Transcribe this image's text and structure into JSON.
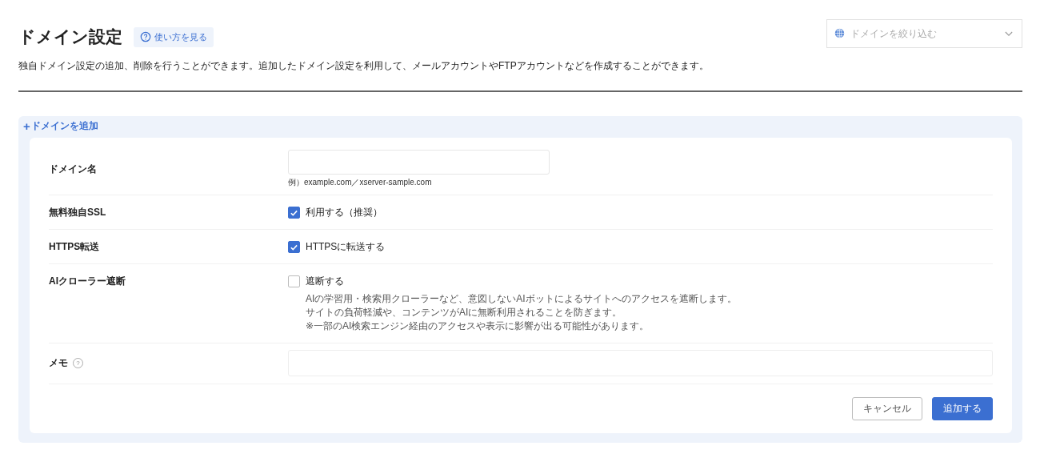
{
  "header": {
    "title": "ドメイン設定",
    "help_link": "使い方を見る",
    "filter": {
      "placeholder": "ドメインを絞り込む"
    },
    "description": "独自ドメイン設定の追加、削除を行うことができます。追加したドメイン設定を利用して、メールアカウントやFTPアカウントなどを作成することができます。"
  },
  "panel": {
    "toggle": {
      "icon": "+",
      "label": "ドメインを追加"
    },
    "rows": [
      {
        "kind": "text",
        "label": "ドメイン名",
        "hint": "例）example.com／xserver-sample.com"
      },
      {
        "kind": "checkbox",
        "label": "無料独自SSL",
        "option": "利用する（推奨）",
        "checked": true
      },
      {
        "kind": "checkbox",
        "label": "HTTPS転送",
        "option": "HTTPSに転送する",
        "checked": true
      },
      {
        "kind": "checkbox",
        "label": "AIクローラー遮断",
        "option": "遮断する",
        "checked": false,
        "notes": [
          "AIの学習用・検索用クローラーなど、意図しないAIボットによるサイトへのアクセスを遮断します。",
          "サイトの負荷軽減や、コンテンツがAIに無断利用されることを防ぎます。",
          "※一部のAI検索エンジン経由のアクセスや表示に影響が出る可能性があります。"
        ]
      },
      {
        "kind": "memo",
        "label": "メモ",
        "help": "?"
      }
    ],
    "buttons": [
      {
        "kind": "secondary",
        "label": "キャンセル"
      },
      {
        "kind": "primary",
        "label": "追加する"
      }
    ]
  }
}
